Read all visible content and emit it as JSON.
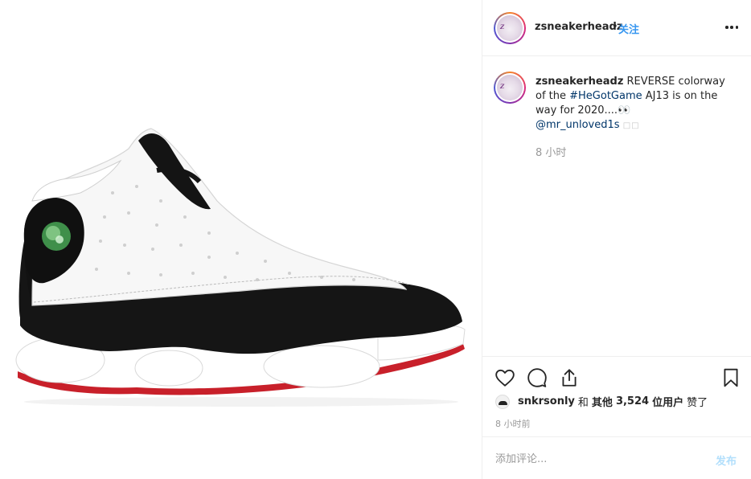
{
  "post": {
    "image_alt": "Air Jordan 13 sneaker"
  },
  "header": {
    "username": "zsneakerheadz",
    "dot": "•",
    "follow_label": "关注"
  },
  "caption": {
    "username": "zsneakerheadz",
    "text_1": " REVERSE colorway of the ",
    "hashtag": "#HeGotGame",
    "text_2": " AJ13 is on the way for 2020....👀",
    "mention": "@mr_unloved1s",
    "trailing_boxes": " □□",
    "time": "8 小时"
  },
  "actions": {
    "like": "heart-icon",
    "comment": "comment-icon",
    "share": "share-icon",
    "save": "bookmark-icon"
  },
  "likes": {
    "user": "snkrsonly",
    "and": "和",
    "others_prefix": "其他",
    "count": "3,524",
    "others_suffix": "位用户",
    "verb": "赞了"
  },
  "post_time": "8 小时前",
  "comment_box": {
    "placeholder": "添加评论...",
    "post_label": "发布"
  },
  "colors": {
    "link": "#003569",
    "follow": "#3897f0",
    "post_disabled": "#b2dffc",
    "muted": "#999999"
  }
}
